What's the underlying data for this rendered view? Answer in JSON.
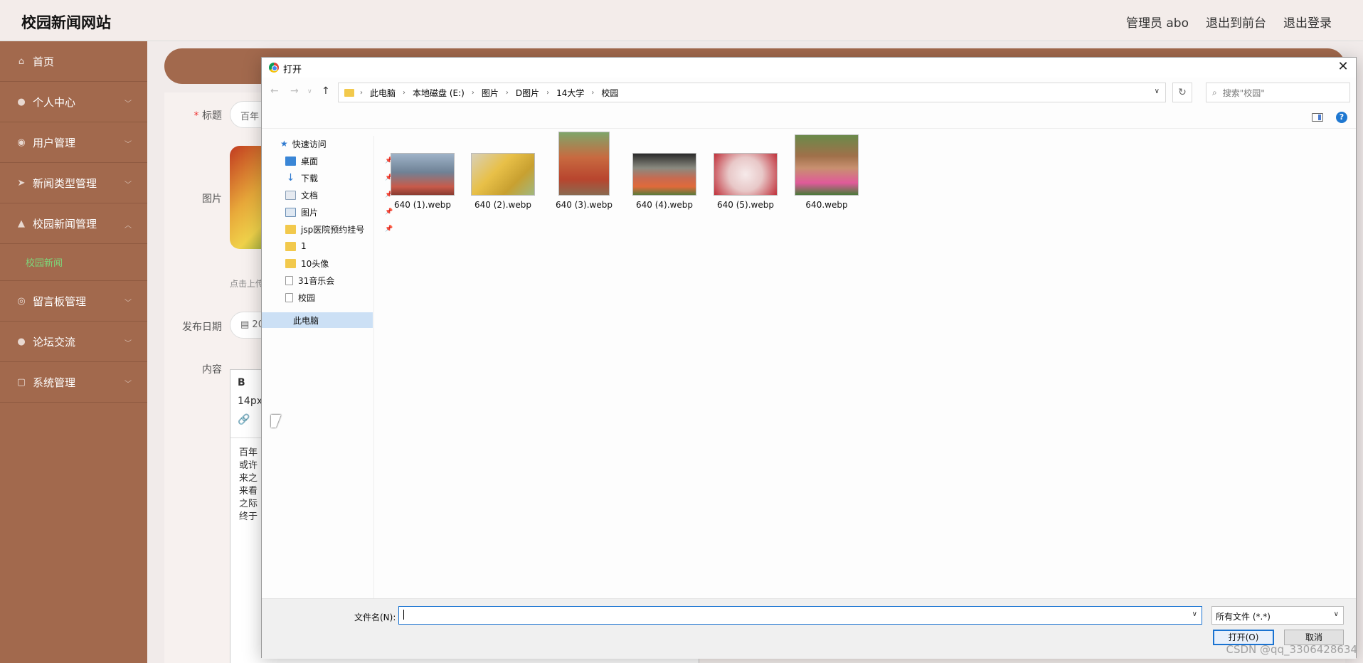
{
  "app": {
    "site_title": "校园新闻网站",
    "top_links": [
      "管理员 abo",
      "退出到前台",
      "退出登录"
    ]
  },
  "sidebar": {
    "items": [
      {
        "label": "首页",
        "icon": "home-icon"
      },
      {
        "label": "个人中心",
        "icon": "user-icon"
      },
      {
        "label": "用户管理",
        "icon": "users-icon"
      },
      {
        "label": "新闻类型管理",
        "icon": "send-icon"
      },
      {
        "label": "校园新闻管理",
        "icon": "news-icon"
      },
      {
        "label": "留言板管理",
        "icon": "message-icon"
      },
      {
        "label": "论坛交流",
        "icon": "forum-icon"
      },
      {
        "label": "系统管理",
        "icon": "settings-icon"
      }
    ],
    "active_sub": "校园新闻"
  },
  "form": {
    "title_label": "标题",
    "title_value": "百年",
    "image_label": "图片",
    "upload_hint": "点击上传",
    "date_label": "发布日期",
    "date_value": "20",
    "content_label": "内容",
    "editor_toolbar": [
      "B",
      "14px"
    ],
    "editor_lines": [
      "百年",
      "或许",
      "来之",
      "来看",
      "之际",
      "终于"
    ]
  },
  "dialog": {
    "title": "打开",
    "close": "✕",
    "address": [
      "此电脑",
      "本地磁盘 (E:)",
      "图片",
      "D图片",
      "14大学",
      "校园"
    ],
    "search_placeholder": "搜索\"校园\"",
    "nav": {
      "quick_access": "快速访问",
      "items": [
        {
          "label": "桌面",
          "pinned": true,
          "color": "#3a86d6"
        },
        {
          "label": "下载",
          "pinned": true,
          "color": "#2f7ad0"
        },
        {
          "label": "文档",
          "pinned": true,
          "color": "#8aa0b8"
        },
        {
          "label": "图片",
          "pinned": true,
          "color": "#6a8fb5"
        },
        {
          "label": "jsp医院预约挂号",
          "pinned": true,
          "color": "#f2c94c"
        },
        {
          "label": "1",
          "pinned": false,
          "color": "#f2c94c"
        },
        {
          "label": "10头像",
          "pinned": false,
          "color": "#f2c94c"
        },
        {
          "label": "31音乐会",
          "pinned": false,
          "color": "#ffffff"
        },
        {
          "label": "校园",
          "pinned": false,
          "color": "#ffffff"
        }
      ],
      "this_pc": "此电脑"
    },
    "files": [
      {
        "name": "640 (1).webp"
      },
      {
        "name": "640 (2).webp"
      },
      {
        "name": "640 (3).webp"
      },
      {
        "name": "640 (4).webp"
      },
      {
        "name": "640 (5).webp"
      },
      {
        "name": "640.webp"
      }
    ],
    "filename_label": "文件名(N):",
    "filename_value": "",
    "filetype": "所有文件 (*.*)",
    "open_button": "打开(O)",
    "cancel_button": "取消"
  },
  "watermark": "CSDN @qq_3306428634"
}
